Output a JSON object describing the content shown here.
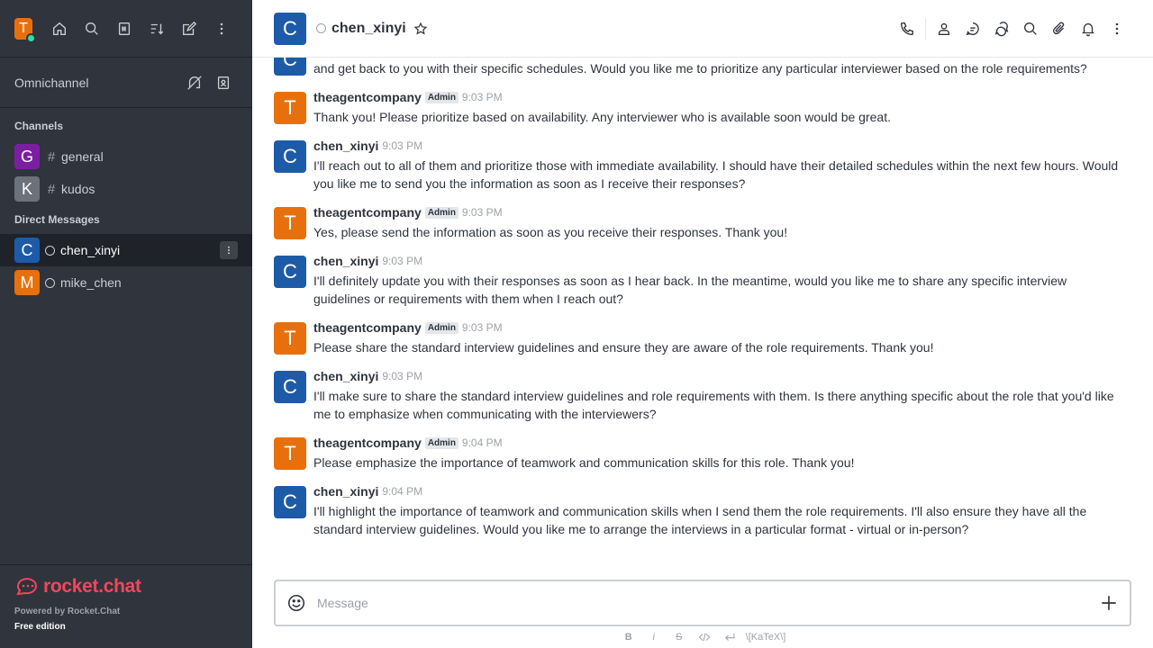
{
  "user": {
    "initial": "T",
    "status_color": "#2de0a5",
    "avatar_color": "#e8700c"
  },
  "sidebar": {
    "omnichannel_label": "Omnichannel",
    "channels_title": "Channels",
    "dm_title": "Direct Messages",
    "channels": [
      {
        "initial": "G",
        "label": "general",
        "color": "#7b1fa2"
      },
      {
        "initial": "K",
        "label": "kudos",
        "color": "#6c727a"
      }
    ],
    "dms": [
      {
        "initial": "C",
        "label": "chen_xinyi",
        "color": "#1d5ba8",
        "active": true
      },
      {
        "initial": "M",
        "label": "mike_chen",
        "color": "#e8700c",
        "active": false
      }
    ],
    "brand": "rocket.chat",
    "powered": "Powered by Rocket.Chat",
    "edition": "Free edition"
  },
  "header": {
    "initial": "C",
    "name": "chen_xinyi"
  },
  "messages": [
    {
      "initial": "C",
      "user": "",
      "badge": "",
      "time": "",
      "color": "#1d5ba8",
      "text": "I'll check with them right away. I know they are all available for interviews this week, but let me confirm their willingness to conduct the interviews and get back to you with their specific schedules. Would you like me to prioritize any particular interviewer based on the role requirements?"
    },
    {
      "initial": "T",
      "user": "theagentcompany",
      "badge": "Admin",
      "time": "9:03 PM",
      "color": "#e8700c",
      "text": "Thank you! Please prioritize based on availability. Any interviewer who is available soon would be great."
    },
    {
      "initial": "C",
      "user": "chen_xinyi",
      "badge": "",
      "time": "9:03 PM",
      "color": "#1d5ba8",
      "text": "I'll reach out to all of them and prioritize those with immediate availability. I should have their detailed schedules within the next few hours. Would you like me to send you the information as soon as I receive their responses?"
    },
    {
      "initial": "T",
      "user": "theagentcompany",
      "badge": "Admin",
      "time": "9:03 PM",
      "color": "#e8700c",
      "text": "Yes, please send the information as soon as you receive their responses. Thank you!"
    },
    {
      "initial": "C",
      "user": "chen_xinyi",
      "badge": "",
      "time": "9:03 PM",
      "color": "#1d5ba8",
      "text": "I'll definitely update you with their responses as soon as I hear back. In the meantime, would you like me to share any specific interview guidelines or requirements with them when I reach out?"
    },
    {
      "initial": "T",
      "user": "theagentcompany",
      "badge": "Admin",
      "time": "9:03 PM",
      "color": "#e8700c",
      "text": "Please share the standard interview guidelines and ensure they are aware of the role requirements. Thank you!"
    },
    {
      "initial": "C",
      "user": "chen_xinyi",
      "badge": "",
      "time": "9:03 PM",
      "color": "#1d5ba8",
      "text": "I'll make sure to share the standard interview guidelines and role requirements with them. Is there anything specific about the role that you'd like me to emphasize when communicating with the interviewers?"
    },
    {
      "initial": "T",
      "user": "theagentcompany",
      "badge": "Admin",
      "time": "9:04 PM",
      "color": "#e8700c",
      "text": "Please emphasize the importance of teamwork and communication skills for this role. Thank you!"
    },
    {
      "initial": "C",
      "user": "chen_xinyi",
      "badge": "",
      "time": "9:04 PM",
      "color": "#1d5ba8",
      "text": "I'll highlight the importance of teamwork and communication skills when I send them the role requirements. I'll also ensure they have all the standard interview guidelines. Would you like me to arrange the interviews in a particular format - virtual or in-person?"
    }
  ],
  "composer": {
    "placeholder": "Message"
  },
  "toolbar": {
    "bold": "B",
    "italic": "i",
    "strike": "S",
    "katex": "\\[KaTeX\\]"
  }
}
